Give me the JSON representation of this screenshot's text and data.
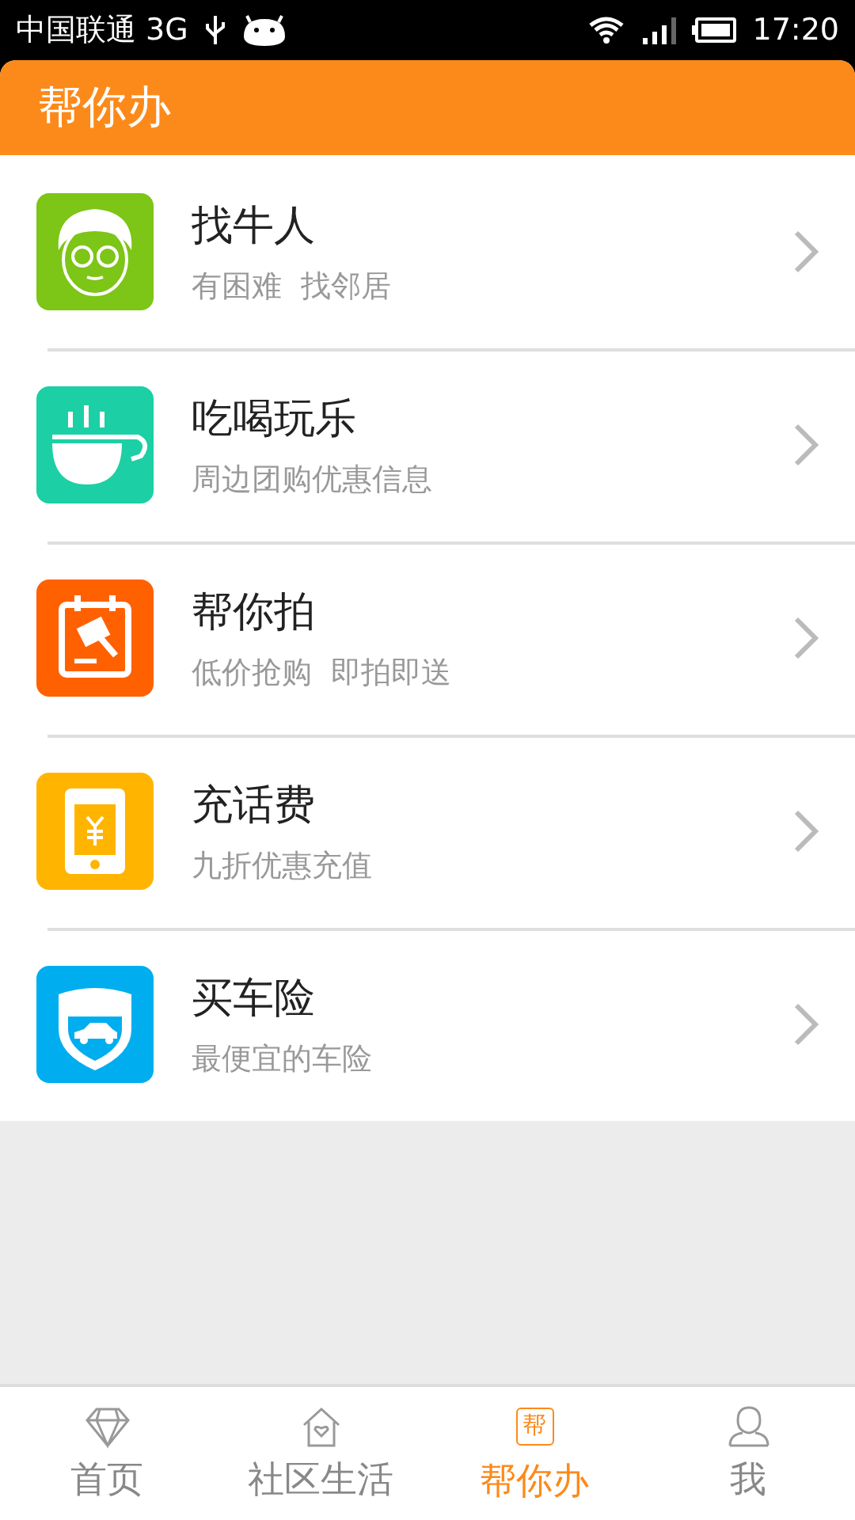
{
  "status_bar": {
    "carrier": "中国联通 3G",
    "time": "17:20"
  },
  "header": {
    "title": "帮你办"
  },
  "items": [
    {
      "title": "找牛人",
      "subtitle": "有困难  找邻居",
      "kind": "face",
      "color": "#7dc516"
    },
    {
      "title": "吃喝玩乐",
      "subtitle": "周边团购优惠信息",
      "kind": "cup",
      "color": "#1ccfa5"
    },
    {
      "title": "帮你拍",
      "subtitle": "低价抢购  即拍即送",
      "kind": "auction",
      "color": "#ff6100"
    },
    {
      "title": "充话费",
      "subtitle": "九折优惠充值",
      "kind": "phone",
      "color": "#ffb400"
    },
    {
      "title": "买车险",
      "subtitle": "最便宜的车险",
      "kind": "car",
      "color": "#00aeef"
    }
  ],
  "tabs": [
    {
      "label": "首页",
      "kind": "diamond",
      "selected": false
    },
    {
      "label": "社区生活",
      "kind": "house",
      "selected": false
    },
    {
      "label": "帮你办",
      "kind": "badge",
      "badge": "帮",
      "selected": true
    },
    {
      "label": "我",
      "kind": "person",
      "selected": false
    }
  ]
}
